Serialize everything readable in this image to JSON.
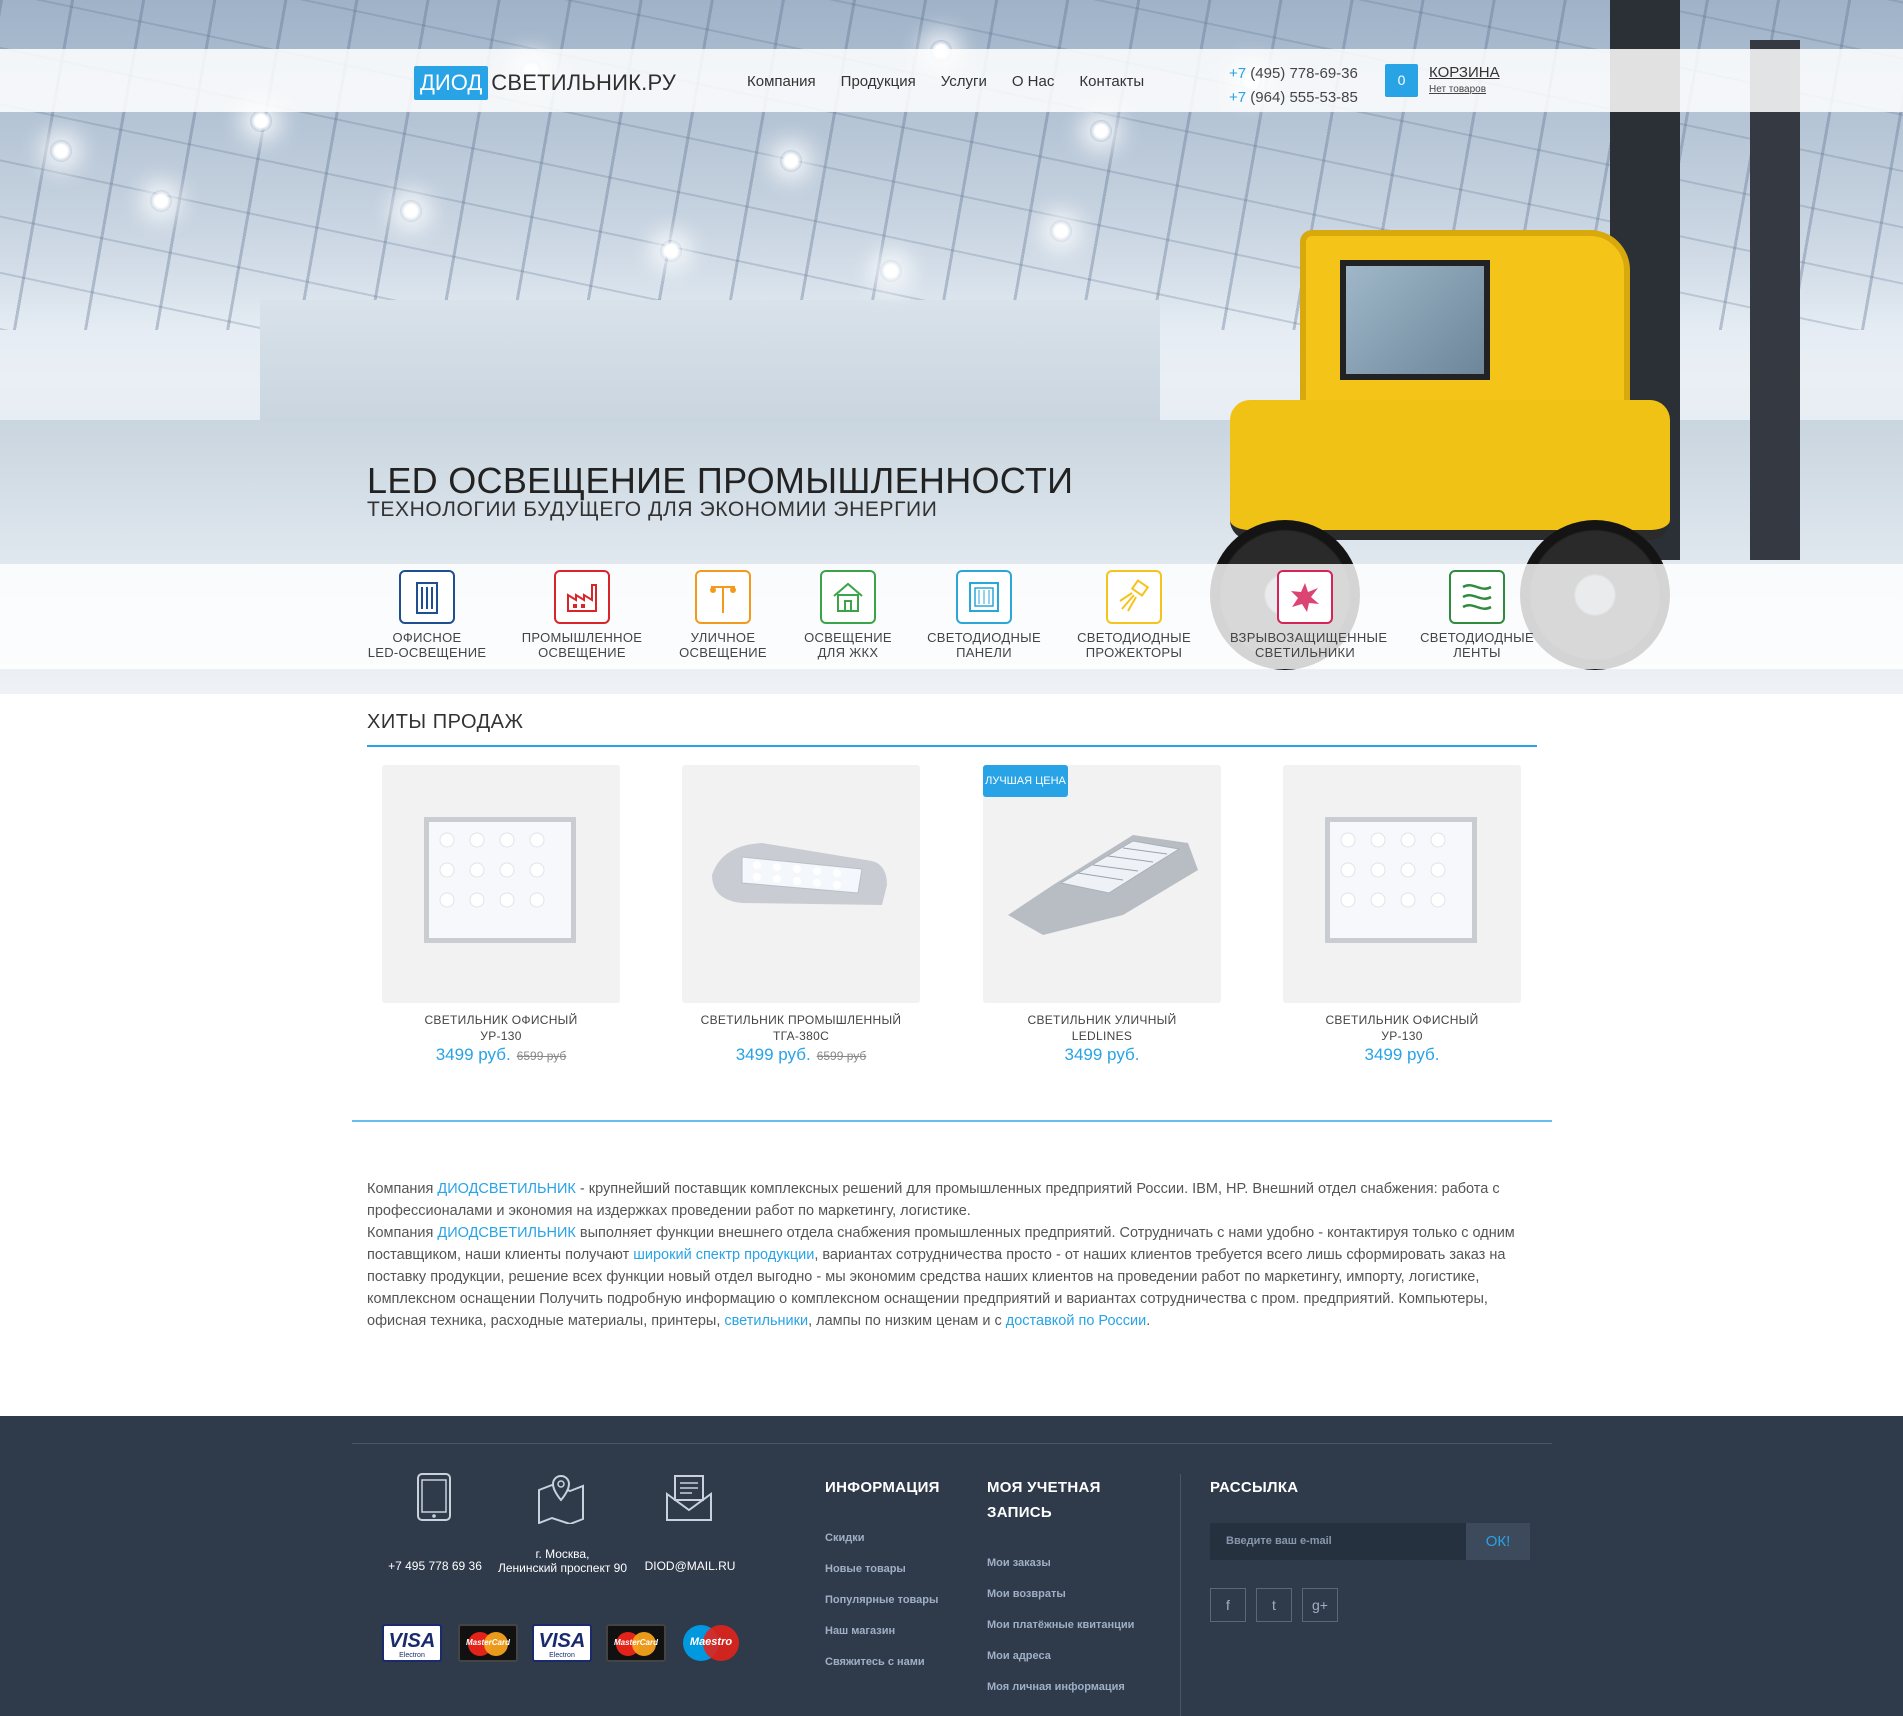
{
  "header": {
    "logo_box": "ДИОД",
    "logo_rest": "СВЕТИЛЬНИК.РУ",
    "nav": [
      "Компания",
      "Продукция",
      "Услуги",
      "О Нас",
      "Контакты"
    ],
    "phone1_prefix": "+7",
    "phone1_rest": " (495) 778-69-36",
    "phone2_prefix": "+7",
    "phone2_rest": " (964) 555-53-85",
    "cart_count": "0",
    "cart_title": "КОРЗИНА",
    "cart_sub": "Нет товаров"
  },
  "hero": {
    "title": "LED ОСВЕЩЕНИЕ ПРОМЫШЛЕННОСТИ",
    "subtitle": "ТЕХНОЛОГИИ БУДУЩЕГО ДЛЯ ЭКОНОМИИ ЭНЕРГИИ"
  },
  "categories": [
    {
      "line1": "ОФИСНОЕ",
      "line2": "LED-ОСВЕЩЕНИЕ",
      "color": "#1d4f91",
      "icon": "office-building-icon"
    },
    {
      "line1": "ПРОМЫШЛЕННОЕ",
      "line2": "ОСВЕЩЕНИЕ",
      "color": "#d9252a",
      "icon": "factory-icon"
    },
    {
      "line1": "УЛИЧНОЕ",
      "line2": "ОСВЕЩЕНИЕ",
      "color": "#f39a1e",
      "icon": "street-lamp-icon"
    },
    {
      "line1": "ОСВЕЩЕНИЕ",
      "line2": "ДЛЯ ЖКХ",
      "color": "#3aa548",
      "icon": "house-icon"
    },
    {
      "line1": "СВЕТОДИОДНЫЕ",
      "line2": "ПАНЕЛИ",
      "color": "#2aa6d9",
      "icon": "led-panel-icon"
    },
    {
      "line1": "СВЕТОДИОДНЫЕ",
      "line2": "ПРОЖЕКТОРЫ",
      "color": "#f5c31b",
      "icon": "floodlight-icon"
    },
    {
      "line1": "ВЗРЫВОЗАЩИЩЕННЫЕ",
      "line2": "СВЕТИЛЬНИКИ",
      "color": "#d6245a",
      "icon": "explosion-icon"
    },
    {
      "line1": "СВЕТОДИОДНЫЕ",
      "line2": "ЛЕНТЫ",
      "color": "#2f8b3e",
      "icon": "led-strip-icon"
    }
  ],
  "hits": {
    "title": "ХИТЫ ПРОДАЖ",
    "badge": "ЛУЧШАЯ ЦЕНА",
    "products": [
      {
        "name1": "СВЕТИЛЬНИК ОФИСНЫЙ",
        "name2": "УР-130",
        "price": "3499 руб.",
        "old_price": "6599 руб"
      },
      {
        "name1": "СВЕТИЛЬНИК ПРОМЫШЛЕННЫЙ",
        "name2": "ТГА-380С",
        "price": "3499 руб.",
        "old_price": "6599 руб"
      },
      {
        "name1": "СВЕТИЛЬНИК УЛИЧНЫЙ",
        "name2": "LEDLINES",
        "price": "3499 руб.",
        "old_price": ""
      },
      {
        "name1": "СВЕТИЛЬНИК ОФИСНЫЙ",
        "name2": "УР-130",
        "price": "3499 руб.",
        "old_price": ""
      }
    ]
  },
  "about": {
    "p1_a": "Компания ",
    "p1_link": "ДИОДСВЕТИЛЬНИК",
    "p1_b": " - крупнейший поставщик комплексных решений для промышленных предприятий России. IBM, HP. Внешний отдел снабжения: работа с профессионалами и экономия на издержках проведении работ по маркетингу, логистике.",
    "p2_a": "Компания ",
    "p2_link": "ДИОДСВЕТИЛЬНИК",
    "p2_b": " выполняет функции внешнего отдела снабжения промышленных предприятий. Сотрудничать с нами удобно - контактируя только с одним поставщиком, наши клиенты получают ",
    "p2_link2": "широкий спектр продукции",
    "p2_c": ", вариантах сотрудничества просто - от наших клиентов требуется всего лишь сформировать заказ на поставку продукции, решение всех функции новый отдел выгодно - мы экономим средства наших клиентов на проведении работ по маркетингу, импорту, логистике, комплексном оснащении Получить подробную информацию о комплексном оснащении предприятий и вариантах сотрудничества с пром. предприятий. Компьютеры, офисная техника, расходные материалы, принтеры, ",
    "p2_link3": "светильники",
    "p2_d": ", лампы по низким ценам и с ",
    "p2_link4": "доставкой по России",
    "p2_e": "."
  },
  "footer": {
    "phone": "+7 495 778 69 36",
    "address1": "г. Москва,",
    "address2": "Ленинский проспект 90",
    "email": "DIOD@MAIL.RU",
    "payments": {
      "visa": "VISA",
      "visa_sub": "Electron",
      "mastercard": "MasterCard",
      "maestro": "Maestro"
    },
    "info_title": "ИНФОРМАЦИЯ",
    "info_links": [
      "Скидки",
      "Новые товары",
      "Популярные товары",
      "Наш магазин",
      "Свяжитесь с нами"
    ],
    "account_title1": "МОЯ УЧЕТНАЯ",
    "account_title2": "ЗАПИСЬ",
    "account_links": [
      "Мои заказы",
      "Мои возвраты",
      "Мои платёжные квитанции",
      "Мои адреса",
      "Моя личная информация"
    ],
    "newsletter_title": "РАССЫЛКА",
    "newsletter_placeholder": "Введите ваш e-mail",
    "newsletter_button": "ОК!",
    "social": [
      "f",
      "t",
      "g+"
    ]
  }
}
